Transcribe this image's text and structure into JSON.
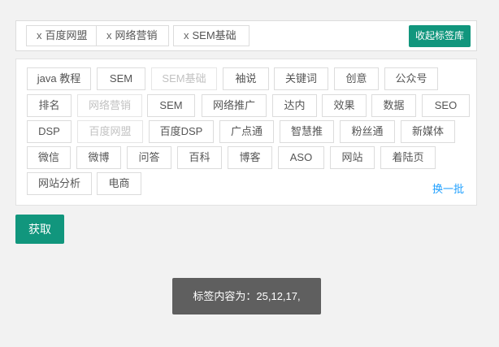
{
  "selected": {
    "remove_glyph": "x",
    "tags": [
      "百度网盟",
      "网络营销",
      "SEM基础"
    ]
  },
  "collect_button": "收起标签库",
  "tags": [
    {
      "label": "java 教程",
      "disabled": false
    },
    {
      "label": "SEM",
      "disabled": false
    },
    {
      "label": "SEM基础",
      "disabled": true
    },
    {
      "label": "袖说",
      "disabled": false
    },
    {
      "label": "关键词",
      "disabled": false
    },
    {
      "label": "创意",
      "disabled": false
    },
    {
      "label": "公众号",
      "disabled": false
    },
    {
      "label": "排名",
      "disabled": false
    },
    {
      "label": "网络营销",
      "disabled": true
    },
    {
      "label": "SEM",
      "disabled": false
    },
    {
      "label": "网络推广",
      "disabled": false
    },
    {
      "label": "达内",
      "disabled": false
    },
    {
      "label": "效果",
      "disabled": false
    },
    {
      "label": "数据",
      "disabled": false
    },
    {
      "label": "SEO",
      "disabled": false
    },
    {
      "label": "DSP",
      "disabled": false
    },
    {
      "label": "百度网盟",
      "disabled": true
    },
    {
      "label": "百度DSP",
      "disabled": false
    },
    {
      "label": "广点通",
      "disabled": false
    },
    {
      "label": "智慧推",
      "disabled": false
    },
    {
      "label": "粉丝通",
      "disabled": false
    },
    {
      "label": "新媒体",
      "disabled": false
    },
    {
      "label": "微信",
      "disabled": false
    },
    {
      "label": "微博",
      "disabled": false
    },
    {
      "label": "问答",
      "disabled": false
    },
    {
      "label": "百科",
      "disabled": false
    },
    {
      "label": "博客",
      "disabled": false
    },
    {
      "label": "ASO",
      "disabled": false
    },
    {
      "label": "网站",
      "disabled": false
    },
    {
      "label": "着陆页",
      "disabled": false
    },
    {
      "label": "网站分析",
      "disabled": false
    },
    {
      "label": "电商",
      "disabled": false
    }
  ],
  "swap_link": "换一批",
  "fetch_button": "获取",
  "toast": "标签内容为：25,12,17,",
  "colors": {
    "accent": "#11967d",
    "link": "#1e9fff",
    "disabled_text": "#c2c2c2",
    "toast_bg": "#5f5f5f"
  }
}
